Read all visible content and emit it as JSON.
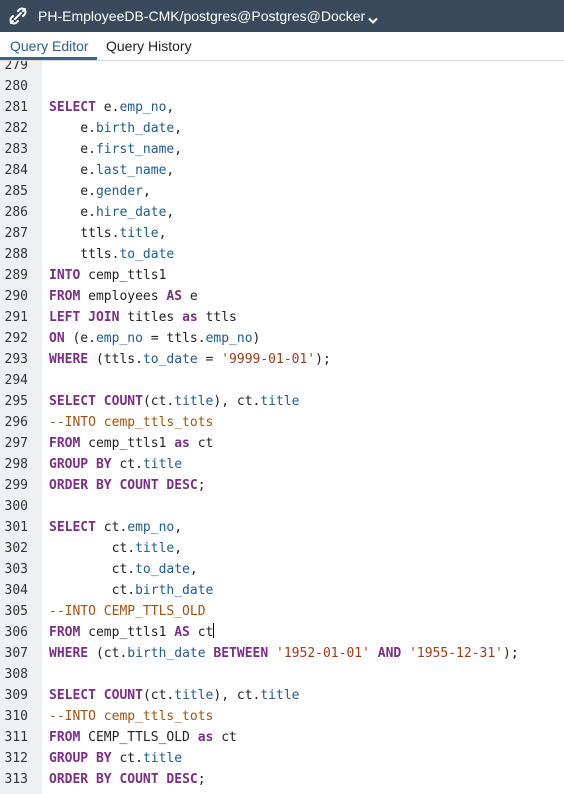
{
  "connection": {
    "title": "PH-EmployeeDB-CMK/postgres@Postgres@Docker",
    "icon": "connection-plug-icon",
    "dropdown_icon": "chevron-down-icon"
  },
  "tabs": [
    {
      "label": "Query Editor",
      "active": true
    },
    {
      "label": "Query History",
      "active": false
    }
  ],
  "colors": {
    "header_bg": "#3a4a5c",
    "keyword": "#7a2e86",
    "field": "#1e5c94",
    "string": "#a03b18",
    "comment": "#a55210",
    "active_tab": "#326690"
  },
  "editor": {
    "lines": [
      {
        "n": "279",
        "tokens": []
      },
      {
        "n": "280",
        "tokens": []
      },
      {
        "n": "281",
        "tokens": [
          {
            "t": "SELECT",
            "c": "kw"
          },
          {
            "t": " e.",
            "c": ""
          },
          {
            "t": "emp_no",
            "c": "fld"
          },
          {
            "t": ",",
            "c": ""
          }
        ]
      },
      {
        "n": "282",
        "tokens": [
          {
            "t": "    e.",
            "c": ""
          },
          {
            "t": "birth_date",
            "c": "fld"
          },
          {
            "t": ",",
            "c": ""
          }
        ]
      },
      {
        "n": "283",
        "tokens": [
          {
            "t": "    e.",
            "c": ""
          },
          {
            "t": "first_name",
            "c": "fld"
          },
          {
            "t": ",",
            "c": ""
          }
        ]
      },
      {
        "n": "284",
        "tokens": [
          {
            "t": "    e.",
            "c": ""
          },
          {
            "t": "last_name",
            "c": "fld"
          },
          {
            "t": ",",
            "c": ""
          }
        ]
      },
      {
        "n": "285",
        "tokens": [
          {
            "t": "    e.",
            "c": ""
          },
          {
            "t": "gender",
            "c": "fld"
          },
          {
            "t": ",",
            "c": ""
          }
        ]
      },
      {
        "n": "286",
        "tokens": [
          {
            "t": "    e.",
            "c": ""
          },
          {
            "t": "hire_date",
            "c": "fld"
          },
          {
            "t": ",",
            "c": ""
          }
        ]
      },
      {
        "n": "287",
        "tokens": [
          {
            "t": "    ttls.",
            "c": ""
          },
          {
            "t": "title",
            "c": "fld"
          },
          {
            "t": ",",
            "c": ""
          }
        ]
      },
      {
        "n": "288",
        "tokens": [
          {
            "t": "    ttls.",
            "c": ""
          },
          {
            "t": "to_date",
            "c": "fld"
          }
        ]
      },
      {
        "n": "289",
        "tokens": [
          {
            "t": "INTO",
            "c": "kw"
          },
          {
            "t": " cemp_ttls1",
            "c": ""
          }
        ]
      },
      {
        "n": "290",
        "tokens": [
          {
            "t": "FROM",
            "c": "kw"
          },
          {
            "t": " employees ",
            "c": ""
          },
          {
            "t": "AS",
            "c": "kw"
          },
          {
            "t": " e",
            "c": ""
          }
        ]
      },
      {
        "n": "291",
        "tokens": [
          {
            "t": "LEFT JOIN",
            "c": "kw"
          },
          {
            "t": " titles ",
            "c": ""
          },
          {
            "t": "as",
            "c": "kw"
          },
          {
            "t": " ttls",
            "c": ""
          }
        ]
      },
      {
        "n": "292",
        "tokens": [
          {
            "t": "ON",
            "c": "kw"
          },
          {
            "t": " (e.",
            "c": ""
          },
          {
            "t": "emp_no",
            "c": "fld"
          },
          {
            "t": " = ttls.",
            "c": ""
          },
          {
            "t": "emp_no",
            "c": "fld"
          },
          {
            "t": ")",
            "c": ""
          }
        ]
      },
      {
        "n": "293",
        "tokens": [
          {
            "t": "WHERE",
            "c": "kw"
          },
          {
            "t": " (ttls.",
            "c": ""
          },
          {
            "t": "to_date",
            "c": "fld"
          },
          {
            "t": " = ",
            "c": ""
          },
          {
            "t": "'9999-01-01'",
            "c": "str"
          },
          {
            "t": ");",
            "c": ""
          }
        ]
      },
      {
        "n": "294",
        "tokens": []
      },
      {
        "n": "295",
        "tokens": [
          {
            "t": "SELECT",
            "c": "kw"
          },
          {
            "t": " ",
            "c": ""
          },
          {
            "t": "COUNT",
            "c": "kw"
          },
          {
            "t": "(ct.",
            "c": ""
          },
          {
            "t": "title",
            "c": "fld"
          },
          {
            "t": "), ct.",
            "c": ""
          },
          {
            "t": "title",
            "c": "fld"
          }
        ]
      },
      {
        "n": "296",
        "tokens": [
          {
            "t": "--INTO cemp_ttls_tots",
            "c": "cmt"
          }
        ]
      },
      {
        "n": "297",
        "tokens": [
          {
            "t": "FROM",
            "c": "kw"
          },
          {
            "t": " cemp_ttls1 ",
            "c": ""
          },
          {
            "t": "as",
            "c": "kw"
          },
          {
            "t": " ct",
            "c": ""
          }
        ]
      },
      {
        "n": "298",
        "tokens": [
          {
            "t": "GROUP BY",
            "c": "kw"
          },
          {
            "t": " ct.",
            "c": ""
          },
          {
            "t": "title",
            "c": "fld"
          }
        ]
      },
      {
        "n": "299",
        "tokens": [
          {
            "t": "ORDER BY",
            "c": "kw"
          },
          {
            "t": " ",
            "c": ""
          },
          {
            "t": "COUNT",
            "c": "kw"
          },
          {
            "t": " ",
            "c": ""
          },
          {
            "t": "DESC",
            "c": "kw"
          },
          {
            "t": ";",
            "c": ""
          }
        ]
      },
      {
        "n": "300",
        "tokens": []
      },
      {
        "n": "301",
        "tokens": [
          {
            "t": "SELECT",
            "c": "kw"
          },
          {
            "t": " ct.",
            "c": ""
          },
          {
            "t": "emp_no",
            "c": "fld"
          },
          {
            "t": ",",
            "c": ""
          }
        ]
      },
      {
        "n": "302",
        "tokens": [
          {
            "t": "        ct.",
            "c": ""
          },
          {
            "t": "title",
            "c": "fld"
          },
          {
            "t": ",",
            "c": ""
          }
        ]
      },
      {
        "n": "303",
        "tokens": [
          {
            "t": "        ct.",
            "c": ""
          },
          {
            "t": "to_date",
            "c": "fld"
          },
          {
            "t": ",",
            "c": ""
          }
        ]
      },
      {
        "n": "304",
        "tokens": [
          {
            "t": "        ct.",
            "c": ""
          },
          {
            "t": "birth_date",
            "c": "fld"
          }
        ]
      },
      {
        "n": "305",
        "tokens": [
          {
            "t": "--INTO CEMP_TTLS_OLD",
            "c": "cmt"
          }
        ]
      },
      {
        "n": "306",
        "tokens": [
          {
            "t": "FROM",
            "c": "kw"
          },
          {
            "t": " cemp_ttls1 ",
            "c": ""
          },
          {
            "t": "AS",
            "c": "kw"
          },
          {
            "t": " ct",
            "c": ""
          },
          {
            "t": "",
            "c": "cursor"
          }
        ]
      },
      {
        "n": "307",
        "tokens": [
          {
            "t": "WHERE",
            "c": "kw"
          },
          {
            "t": " (ct.",
            "c": ""
          },
          {
            "t": "birth_date",
            "c": "fld"
          },
          {
            "t": " ",
            "c": ""
          },
          {
            "t": "BETWEEN",
            "c": "kw"
          },
          {
            "t": " ",
            "c": ""
          },
          {
            "t": "'1952-01-01'",
            "c": "str"
          },
          {
            "t": " ",
            "c": ""
          },
          {
            "t": "AND",
            "c": "kw"
          },
          {
            "t": " ",
            "c": ""
          },
          {
            "t": "'1955-12-31'",
            "c": "str"
          },
          {
            "t": ");",
            "c": ""
          }
        ]
      },
      {
        "n": "308",
        "tokens": []
      },
      {
        "n": "309",
        "tokens": [
          {
            "t": "SELECT",
            "c": "kw"
          },
          {
            "t": " ",
            "c": ""
          },
          {
            "t": "COUNT",
            "c": "kw"
          },
          {
            "t": "(ct.",
            "c": ""
          },
          {
            "t": "title",
            "c": "fld"
          },
          {
            "t": "), ct.",
            "c": ""
          },
          {
            "t": "title",
            "c": "fld"
          }
        ]
      },
      {
        "n": "310",
        "tokens": [
          {
            "t": "--INTO cemp_ttls_tots",
            "c": "cmt"
          }
        ]
      },
      {
        "n": "311",
        "tokens": [
          {
            "t": "FROM",
            "c": "kw"
          },
          {
            "t": " CEMP_TTLS_OLD ",
            "c": ""
          },
          {
            "t": "as",
            "c": "kw"
          },
          {
            "t": " ct",
            "c": ""
          }
        ]
      },
      {
        "n": "312",
        "tokens": [
          {
            "t": "GROUP BY",
            "c": "kw"
          },
          {
            "t": " ct.",
            "c": ""
          },
          {
            "t": "title",
            "c": "fld"
          }
        ]
      },
      {
        "n": "313",
        "tokens": [
          {
            "t": "ORDER BY",
            "c": "kw"
          },
          {
            "t": " ",
            "c": ""
          },
          {
            "t": "COUNT",
            "c": "kw"
          },
          {
            "t": " ",
            "c": ""
          },
          {
            "t": "DESC",
            "c": "kw"
          },
          {
            "t": ";",
            "c": ""
          }
        ]
      }
    ]
  }
}
